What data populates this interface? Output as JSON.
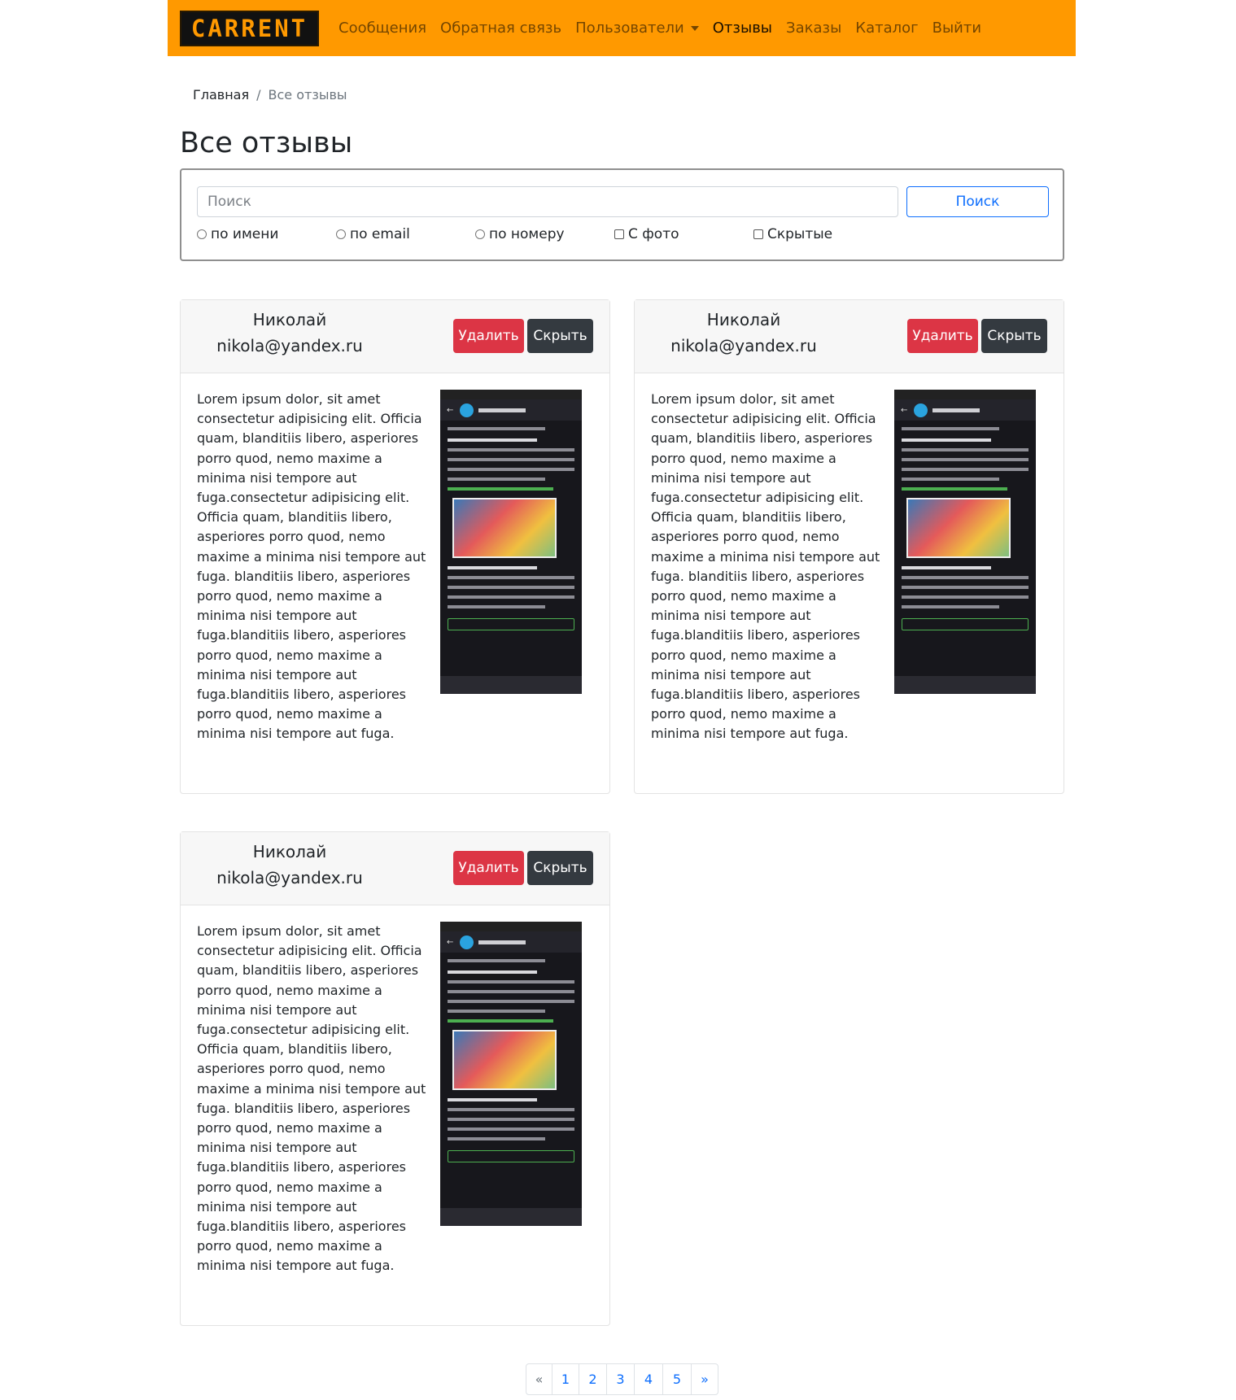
{
  "navbar": {
    "brand": "CARRENT",
    "links": [
      "Сообщения",
      "Обратная связь",
      "Пользователи",
      "Отзывы",
      "Заказы",
      "Каталог",
      "Выйти"
    ],
    "active": "Отзывы"
  },
  "breadcrumb": {
    "home": "Главная",
    "current": "Все отзывы"
  },
  "page_title": "Все отзывы",
  "search": {
    "placeholder": "Поиск",
    "button": "Поиск",
    "filters": [
      {
        "type": "radio",
        "label": "по имени"
      },
      {
        "type": "radio",
        "label": "по email"
      },
      {
        "type": "radio",
        "label": "по номеру"
      },
      {
        "type": "checkbox",
        "label": "С фото"
      },
      {
        "type": "checkbox",
        "label": "Скрытые"
      }
    ]
  },
  "reviews": [
    {
      "name": "Николай",
      "email": "nikola@yandex.ru",
      "delete_label": "Удалить",
      "hide_label": "Скрыть",
      "text": "Lorem ipsum dolor, sit amet consectetur adipisicing elit. Officia quam, blanditiis libero, asperiores porro quod, nemo maxime a minima nisi tempore aut fuga.consectetur adipisicing elit. Officia quam, blanditiis libero, asperiores porro quod, nemo maxime a minima nisi tempore aut fuga. blanditiis libero, asperiores porro quod, nemo maxime a minima nisi tempore aut fuga.blanditiis libero, asperiores porro quod, nemo maxime a minima nisi tempore aut fuga.blanditiis libero, asperiores porro quod, nemo maxime a minima nisi tempore aut fuga."
    },
    {
      "name": "Николай",
      "email": "nikola@yandex.ru",
      "delete_label": "Удалить",
      "hide_label": "Скрыть",
      "text": "Lorem ipsum dolor, sit amet consectetur adipisicing elit. Officia quam, blanditiis libero, asperiores porro quod, nemo maxime a minima nisi tempore aut fuga.consectetur adipisicing elit. Officia quam, blanditiis libero, asperiores porro quod, nemo maxime a minima nisi tempore aut fuga. blanditiis libero, asperiores porro quod, nemo maxime a minima nisi tempore aut fuga.blanditiis libero, asperiores porro quod, nemo maxime a minima nisi tempore aut fuga.blanditiis libero, asperiores porro quod, nemo maxime a minima nisi tempore aut fuga."
    },
    {
      "name": "Николай",
      "email": "nikola@yandex.ru",
      "delete_label": "Удалить",
      "hide_label": "Скрыть",
      "text": "Lorem ipsum dolor, sit amet consectetur adipisicing elit. Officia quam, blanditiis libero, asperiores porro quod, nemo maxime a minima nisi tempore aut fuga.consectetur adipisicing elit. Officia quam, blanditiis libero, asperiores porro quod, nemo maxime a minima nisi tempore aut fuga. blanditiis libero, asperiores porro quod, nemo maxime a minima nisi tempore aut fuga.blanditiis libero, asperiores porro quod, nemo maxime a minima nisi tempore aut fuga.blanditiis libero, asperiores porro quod, nemo maxime a minima nisi tempore aut fuga."
    }
  ],
  "pagination": [
    "«",
    "1",
    "2",
    "3",
    "4",
    "5",
    "»"
  ]
}
